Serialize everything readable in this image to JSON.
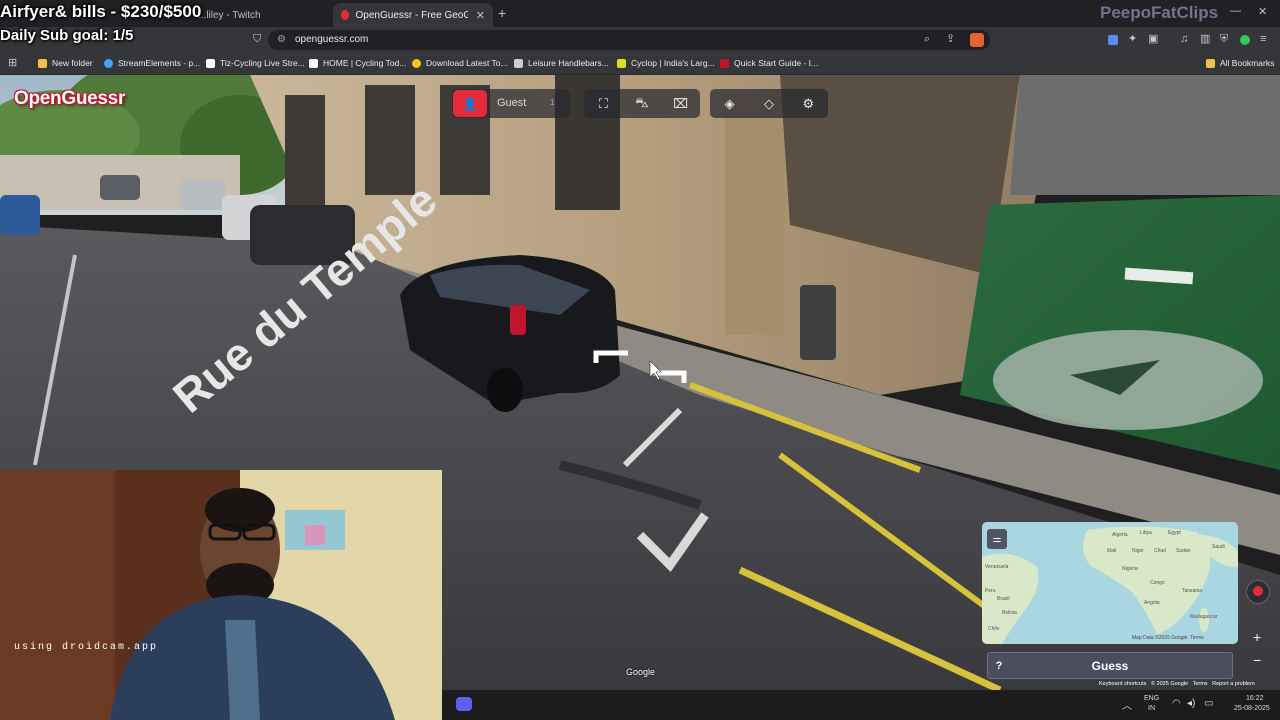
{
  "browser": {
    "tabs": [
      {
        "title": "...liley - Twitch",
        "active": false
      },
      {
        "title": "OpenGuessr - Free GeoGuessr A",
        "active": true
      }
    ],
    "url": "openguessr.com",
    "bookmarks": [
      {
        "label": "New folder",
        "color": "#f0c24a"
      },
      {
        "label": "StreamElements - p...",
        "color": "#3ea6ff"
      },
      {
        "label": "Tiz-Cycling Live Stre...",
        "color": "#ffffff"
      },
      {
        "label": "HOME | Cycling Tod...",
        "color": "#ffffff"
      },
      {
        "label": "Download Latest To...",
        "color": "#f5c518"
      },
      {
        "label": "Leisure Handlebars...",
        "color": "#cccccc"
      },
      {
        "label": "Cyclop | India's Larg...",
        "color": "#d5e21d"
      },
      {
        "label": "Quick Start Guide - I...",
        "color": "#c0152a"
      }
    ],
    "all_bookmarks": "All Bookmarks"
  },
  "stream_overlay": {
    "title_line": "Airfyer& bills - $230/$500",
    "goal_line": "Daily Sub goal: 1/5",
    "watermark": "PeepoFatClips",
    "webcam_text": "using droidcam.app"
  },
  "game": {
    "logo": "OpenGuessr",
    "player_label": "Guest",
    "player_count": "1",
    "street_sign": "Rue du Temple",
    "google_credit": "Google",
    "map_attribution": "Map Data ©2025 Google",
    "map_terms": "Terms",
    "guess_label": "Guess",
    "help_label": "?",
    "keyboard_shortcuts": "Keyboard shortcuts",
    "footer_copyright": "© 2025 Google",
    "footer_terms": "Terms",
    "report_problem": "Report a problem",
    "map_labels": [
      "Algeria",
      "Libya",
      "Egypt",
      "Saudi",
      "Mali",
      "Niger",
      "Chad",
      "Sudan",
      "Venezuela",
      "Brazil",
      "Nigeria",
      "Congo",
      "Angola",
      "Tanzania",
      "Madagascar",
      "Bolivia",
      "Peru",
      "Chile"
    ]
  },
  "taskbar": {
    "lang_top": "ENG",
    "lang_bottom": "IN",
    "time": "16:22",
    "date": "25-08-2025"
  }
}
